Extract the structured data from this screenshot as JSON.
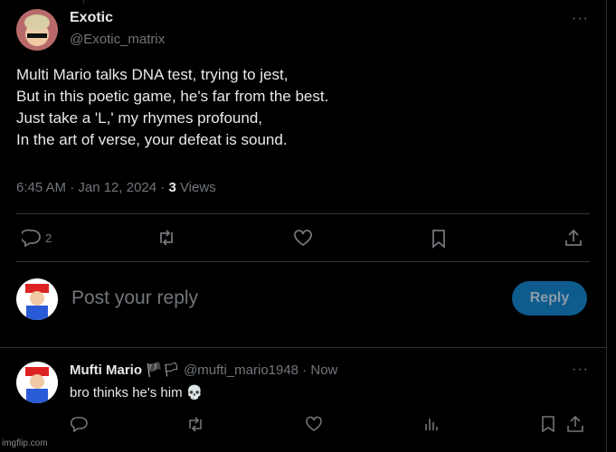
{
  "tweet": {
    "author_name": "Exotic",
    "author_handle": "@Exotic_matrix",
    "lines": [
      "Multi Mario talks DNA test, trying to jest,",
      "But in this poetic game, he's far from the best.",
      "Just take a 'L,' my rhymes profound,",
      "In the art of verse, your defeat is sound."
    ],
    "timestamp": "6:45 AM · Jan 12, 2024 · ",
    "views_count": "3",
    "views_label": " Views",
    "reply_count": "2",
    "more_label": "···"
  },
  "composer": {
    "placeholder": "Post your reply",
    "reply_button": "Reply",
    "accent": "#1d9bf0"
  },
  "reply": {
    "author_name": "Mufti Mario",
    "flags": "🏴🏳",
    "handle_time": "@mufti_mario1948 · Now",
    "text": "bro thinks he's him",
    "emoji": "💀",
    "more_label": "···"
  },
  "watermark": "imgflip.com"
}
